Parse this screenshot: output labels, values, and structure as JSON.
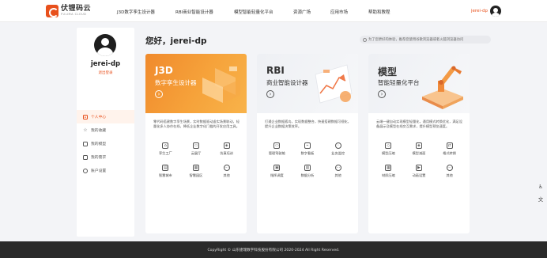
{
  "header": {
    "logo_cn": "伏锂码云",
    "logo_en": "FULIMA CLOUD",
    "nav": [
      "J3D数字孪生设计器",
      "RBI商业智能设计器",
      "模型智能轻量化平台",
      "资源广场",
      "应用市场",
      "帮助和教程"
    ],
    "user_name": "jerei-dp"
  },
  "sidebar": {
    "user_name": "jerei-dp",
    "logout_label": "退出登录",
    "menu": [
      {
        "label": "个人中心",
        "icon": "home-icon",
        "active": true
      },
      {
        "label": "我的收藏",
        "icon": "star-icon",
        "active": false
      },
      {
        "label": "我的模型",
        "icon": "cube-icon",
        "active": false
      },
      {
        "label": "我的需求",
        "icon": "document-icon",
        "active": false
      },
      {
        "label": "账户设置",
        "icon": "gear-icon",
        "active": false
      }
    ]
  },
  "main": {
    "greeting": "您好，jerei-dp",
    "notice": "为了您更好的体验，推荐您使用谷歌浏览器或者火狐浏览器访问"
  },
  "cards": [
    {
      "title": "J3D",
      "subtitle": "数字孪生设计器",
      "theme": "orange",
      "description": "零代码搭建数字孪生场景，实时数据驱动虚实场景联动，轻量化多人协作在线，降低企业数字化门槛的开发应用工具。",
      "features": [
        {
          "label": "孪生工厂",
          "icon": "factory-icon"
        },
        {
          "label": "云展厅",
          "icon": "monitor-icon"
        },
        {
          "label": "仿真培训",
          "icon": "box-icon"
        },
        {
          "label": "智慧城市",
          "icon": "building-icon"
        },
        {
          "label": "智慧园区",
          "icon": "park-icon"
        },
        {
          "label": "其他",
          "icon": "more-icon"
        }
      ]
    },
    {
      "title": "RBI",
      "subtitle": "商业智能设计器",
      "theme": "grey",
      "description": "打通企业数据孤岛，实现数据整合，快速搭建数据可视化，提升企业数据决策效率。",
      "features": [
        {
          "label": "管理驾驶舱",
          "icon": "dashboard-icon"
        },
        {
          "label": "数字看板",
          "icon": "chart-icon"
        },
        {
          "label": "业务监控",
          "icon": "globe-icon"
        },
        {
          "label": "指挥调度",
          "icon": "command-icon"
        },
        {
          "label": "数据分析",
          "icon": "bar-chart-icon"
        },
        {
          "label": "其他",
          "icon": "more-icon"
        }
      ]
    },
    {
      "title": "模型",
      "subtitle": "智能轻量化平台",
      "theme": "grey",
      "description": "云端一键自动实现模型轻量化，通用模式转换优化，满足设备展示及模型在线交互需求，提升模型预览速度。",
      "features": [
        {
          "label": "模型压缩",
          "icon": "compress-icon"
        },
        {
          "label": "模型减面",
          "icon": "mesh-icon"
        },
        {
          "label": "格式转换",
          "icon": "convert-icon"
        },
        {
          "label": "材质压缩",
          "icon": "texture-icon"
        },
        {
          "label": "动画设置",
          "icon": "animation-icon"
        },
        {
          "label": "其他",
          "icon": "more-icon"
        }
      ]
    }
  ],
  "footer": {
    "copyright": "CopyRight © 山东捷瑞数字科技股份有限公司 2020-2024 All Right Reserved."
  },
  "colors": {
    "accent": "#e8501c",
    "card_orange": "#f39a35",
    "footer_bg": "#2a2a2a"
  }
}
